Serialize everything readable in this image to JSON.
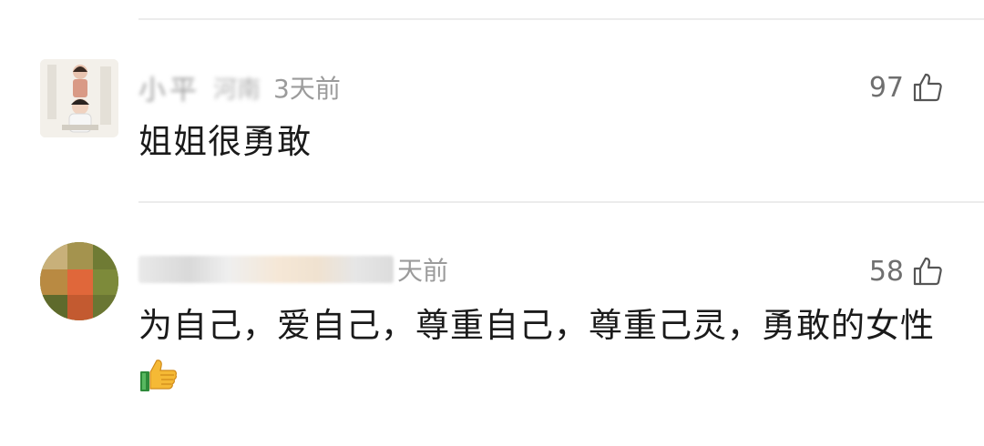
{
  "comments": [
    {
      "nickname": "小平",
      "location": "河南",
      "time": "3天前",
      "likes": "97",
      "text": "姐姐很勇敢"
    },
    {
      "time": "天前",
      "likes": "58",
      "text": "为自己，爱自己，尊重自己，尊重己灵，勇敢的女性"
    }
  ],
  "icons": {
    "like": "thumbs-up-outline-icon",
    "emoji": "thumbs-up-emoji-icon"
  }
}
